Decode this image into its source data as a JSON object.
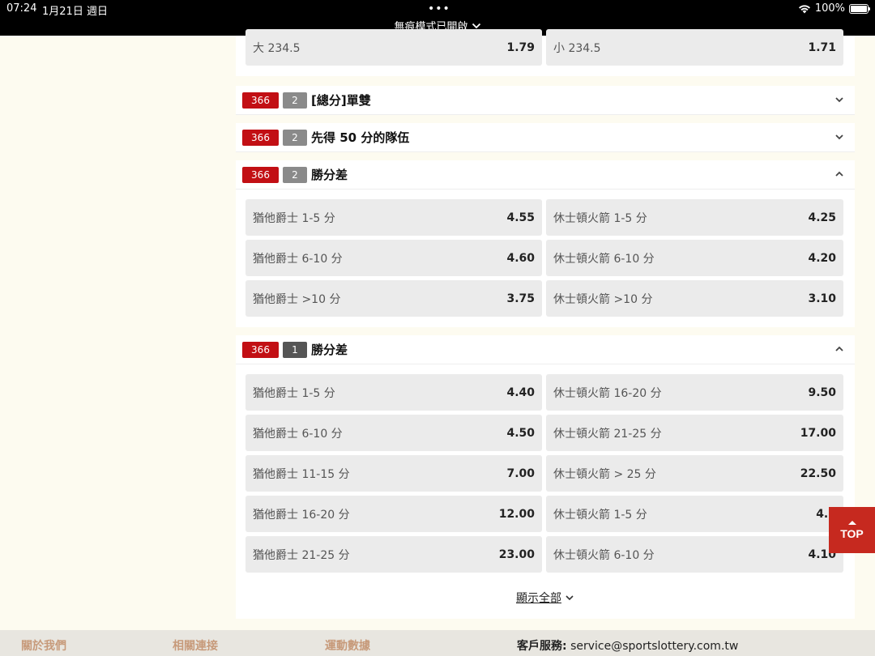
{
  "status_bar": {
    "time": "07:24",
    "date": "1月21日 週日",
    "dots": "•••",
    "battery": "100%",
    "private_mode": "無痕模式已開啟"
  },
  "top_row": [
    {
      "label": "大 234.5",
      "odds": "1.79"
    },
    {
      "label": "小 234.5",
      "odds": "1.71"
    }
  ],
  "markets": [
    {
      "badge": "366",
      "period": "2",
      "title": "[總分]單雙",
      "expanded": false
    },
    {
      "badge": "366",
      "period": "2",
      "title": "先得 50 分的隊伍",
      "expanded": false
    },
    {
      "badge": "366",
      "period": "2",
      "title": "勝分差",
      "expanded": true,
      "rows": [
        [
          {
            "label": "猶他爵士 1-5 分",
            "odds": "4.55"
          },
          {
            "label": "休士頓火箭 1-5 分",
            "odds": "4.25"
          }
        ],
        [
          {
            "label": "猶他爵士 6-10 分",
            "odds": "4.60"
          },
          {
            "label": "休士頓火箭 6-10 分",
            "odds": "4.20"
          }
        ],
        [
          {
            "label": "猶他爵士 >10 分",
            "odds": "3.75"
          },
          {
            "label": "休士頓火箭 >10 分",
            "odds": "3.10"
          }
        ]
      ]
    },
    {
      "badge": "366",
      "period": "1",
      "title": "勝分差",
      "expanded": true,
      "rows": [
        [
          {
            "label": "猶他爵士 1-5 分",
            "odds": "4.40"
          },
          {
            "label": "休士頓火箭 16-20 分",
            "odds": "9.50"
          }
        ],
        [
          {
            "label": "猶他爵士 6-10 分",
            "odds": "4.50"
          },
          {
            "label": "休士頓火箭 21-25 分",
            "odds": "17.00"
          }
        ],
        [
          {
            "label": "猶他爵士 11-15 分",
            "odds": "7.00"
          },
          {
            "label": "休士頓火箭 > 25 分",
            "odds": "22.50"
          }
        ],
        [
          {
            "label": "猶他爵士 16-20 分",
            "odds": "12.00"
          },
          {
            "label": "休士頓火箭 1-5 分",
            "odds": "4.1"
          }
        ],
        [
          {
            "label": "猶他爵士 21-25 分",
            "odds": "23.00"
          },
          {
            "label": "休士頓火箭 6-10 分",
            "odds": "4.10"
          }
        ]
      ]
    }
  ],
  "show_all": "顯示全部",
  "top_button": "TOP",
  "footer": {
    "about": "關於我們",
    "links": "相關連接",
    "stats": "運動數據",
    "service_label": "客戶服務:",
    "service_email": "service@sportslottery.com.tw"
  },
  "colors": {
    "brand_red": "#c20f14",
    "top_button": "#c6291f",
    "footer_link": "#c79a7a"
  }
}
